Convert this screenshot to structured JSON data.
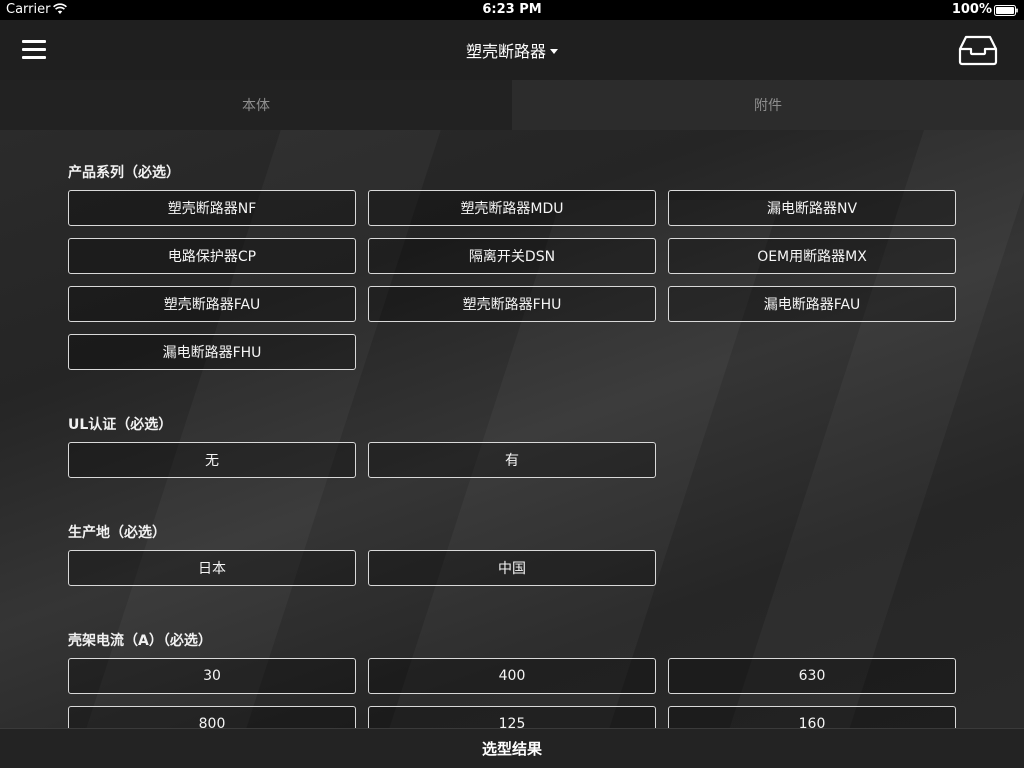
{
  "status_bar": {
    "carrier": "Carrier",
    "time": "6:23 PM",
    "battery": "100%"
  },
  "nav": {
    "title": "塑壳断路器",
    "menu_icon": "hamburger-menu-icon",
    "tray_icon": "inbox-tray-icon"
  },
  "tabs": [
    {
      "label": "本体"
    },
    {
      "label": "附件"
    }
  ],
  "sections": {
    "series": {
      "title": "产品系列（必选）",
      "options": [
        "塑壳断路器NF",
        "塑壳断路器MDU",
        "漏电断路器NV",
        "电路保护器CP",
        "隔离开关DSN",
        "OEM用断路器MX",
        "塑壳断路器FAU",
        "塑壳断路器FHU",
        "漏电断路器FAU",
        "漏电断路器FHU"
      ]
    },
    "ul": {
      "title": "UL认证（必选）",
      "options": [
        "无",
        "有"
      ]
    },
    "origin": {
      "title": "生产地（必选）",
      "options": [
        "日本",
        "中国"
      ]
    },
    "current": {
      "title": "壳架电流（A）（必选）",
      "options": [
        "30",
        "400",
        "630",
        "800",
        "125",
        "160"
      ]
    }
  },
  "bottom": {
    "label": "选型结果"
  },
  "colors": {
    "background": "#262626",
    "status_bar": "#000000",
    "nav_bar": "#1f1f1f",
    "tab_text": "#8e8e8e",
    "option_border": "#d9d9d9"
  }
}
